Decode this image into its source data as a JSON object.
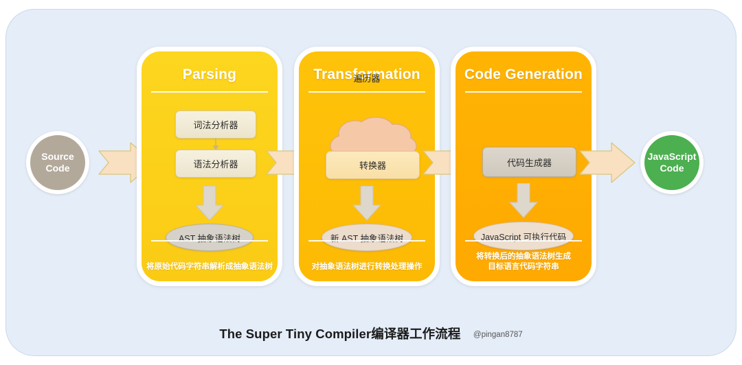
{
  "diagram": {
    "caption_title": "The Super Tiny Compiler编译器工作流程",
    "caption_handle": "@pingan8787",
    "colors": {
      "panel_background": "#e5edf8",
      "parsing": "#fdd21c",
      "transformation": "#fdbe06",
      "code_generation": "#ffaf02",
      "source_node": "#b3a99b",
      "js_node": "#4caf50",
      "arrow_fill": "#f8e0c0",
      "arrow_stroke": "#d8c57c",
      "node_box": "#f2ebd8",
      "cloud": "#f5c9a8",
      "down_arrow": "#ddd6cb"
    }
  },
  "start_node": {
    "label_line1": "Source",
    "label_line2": "Code"
  },
  "end_node": {
    "label_line1": "JavaScript",
    "label_line2": "Code"
  },
  "stages": [
    {
      "title": "Parsing",
      "boxes": [
        {
          "label": "词法分析器"
        },
        {
          "label": "语法分析器"
        }
      ],
      "result": "AST 抽象语法树",
      "footer": "将原始代码字符串解析成抽象语法树"
    },
    {
      "title": "Transformation",
      "cloud": "遍历器",
      "boxes": [
        {
          "label": "转换器"
        }
      ],
      "result": "新 AST 抽象语法树",
      "footer": "对抽象语法树进行转换处理操作"
    },
    {
      "title": "Code Generation",
      "boxes": [
        {
          "label": "代码生成器"
        }
      ],
      "result": "JavaScript 可执行代码",
      "footer_line1": "将转换后的抽象语法树生成",
      "footer_line2": "目标语言代码字符串"
    }
  ],
  "flow_arrows": [
    {
      "name": "source-to-parsing"
    },
    {
      "name": "parsing-to-transformation"
    },
    {
      "name": "transformation-to-codegen"
    },
    {
      "name": "codegen-to-javascript"
    }
  ]
}
